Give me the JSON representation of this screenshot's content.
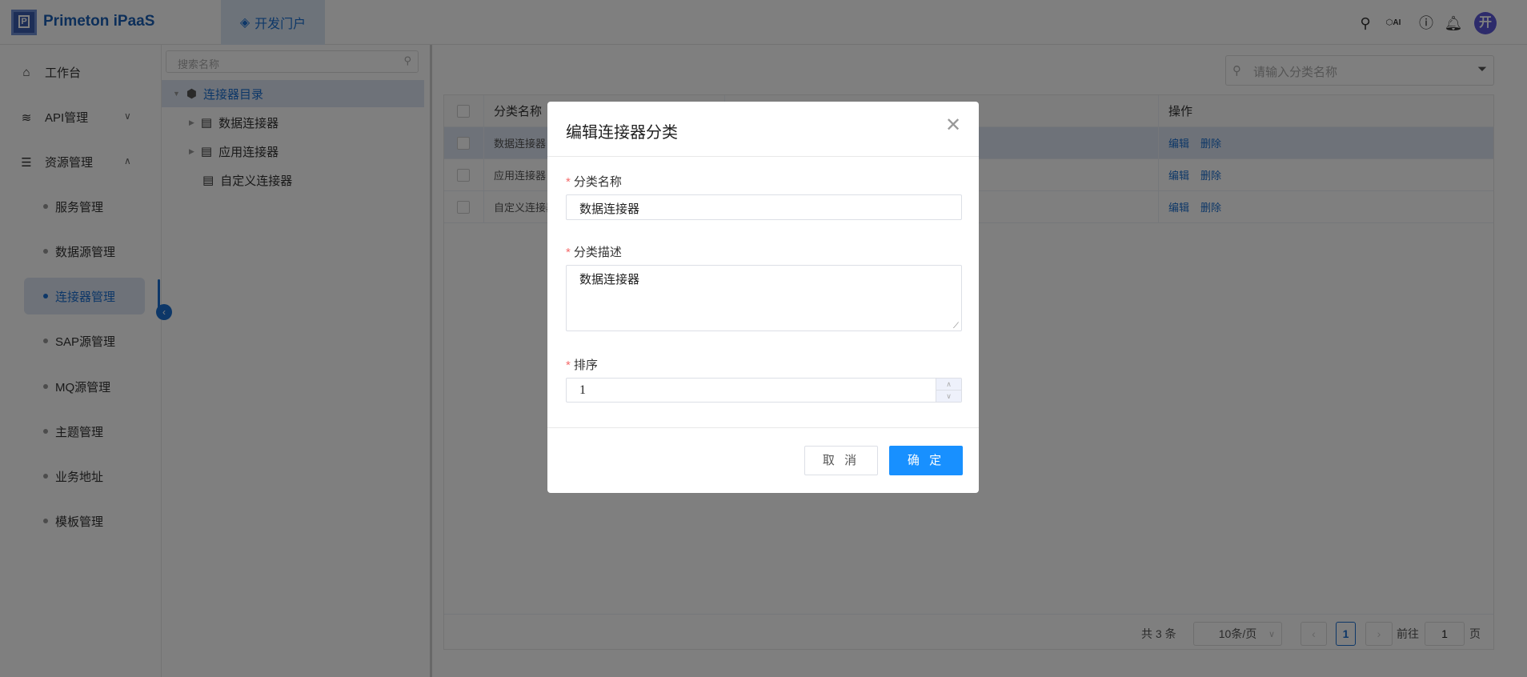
{
  "header": {
    "brand": "Primeton iPaaS",
    "logo_letter": "P",
    "portal_tab": "开发门户",
    "avatar": "开",
    "icons": [
      "search-icon",
      "ai-icon",
      "help-icon",
      "bell-icon"
    ]
  },
  "sidebar": {
    "items": [
      {
        "label": "工作台"
      },
      {
        "label": "API管理"
      },
      {
        "label": "资源管理"
      }
    ],
    "sub_items": [
      {
        "label": "服务管理"
      },
      {
        "label": "数据源管理"
      },
      {
        "label": "连接器管理"
      },
      {
        "label": "SAP源管理"
      },
      {
        "label": "MQ源管理"
      },
      {
        "label": "主题管理"
      },
      {
        "label": "业务地址"
      },
      {
        "label": "模板管理"
      }
    ]
  },
  "tree": {
    "search_placeholder": "搜索名称",
    "root": "连接器目录",
    "children": [
      "数据连接器",
      "应用连接器",
      "自定义连接器"
    ]
  },
  "main": {
    "search_placeholder": "请输入分类名称",
    "columns": [
      "分类名称",
      "操作"
    ],
    "rows": [
      {
        "name": "数据连接器"
      },
      {
        "name": "应用连接器"
      },
      {
        "name": "自定义连接器"
      }
    ],
    "edit": "编辑",
    "delete": "删除",
    "pagination": {
      "total": "共 3 条",
      "page_size": "10条/页",
      "current": "1",
      "goto": "前往",
      "goto_value": "1",
      "page_unit": "页"
    }
  },
  "dialog": {
    "title": "编辑连接器分类",
    "name_label": "分类名称",
    "name_value": "数据连接器",
    "desc_label": "分类描述",
    "desc_value": "数据连接器",
    "sort_label": "排序",
    "sort_value": "1",
    "cancel": "取 消",
    "ok": "确 定",
    "required_mark": "*"
  }
}
